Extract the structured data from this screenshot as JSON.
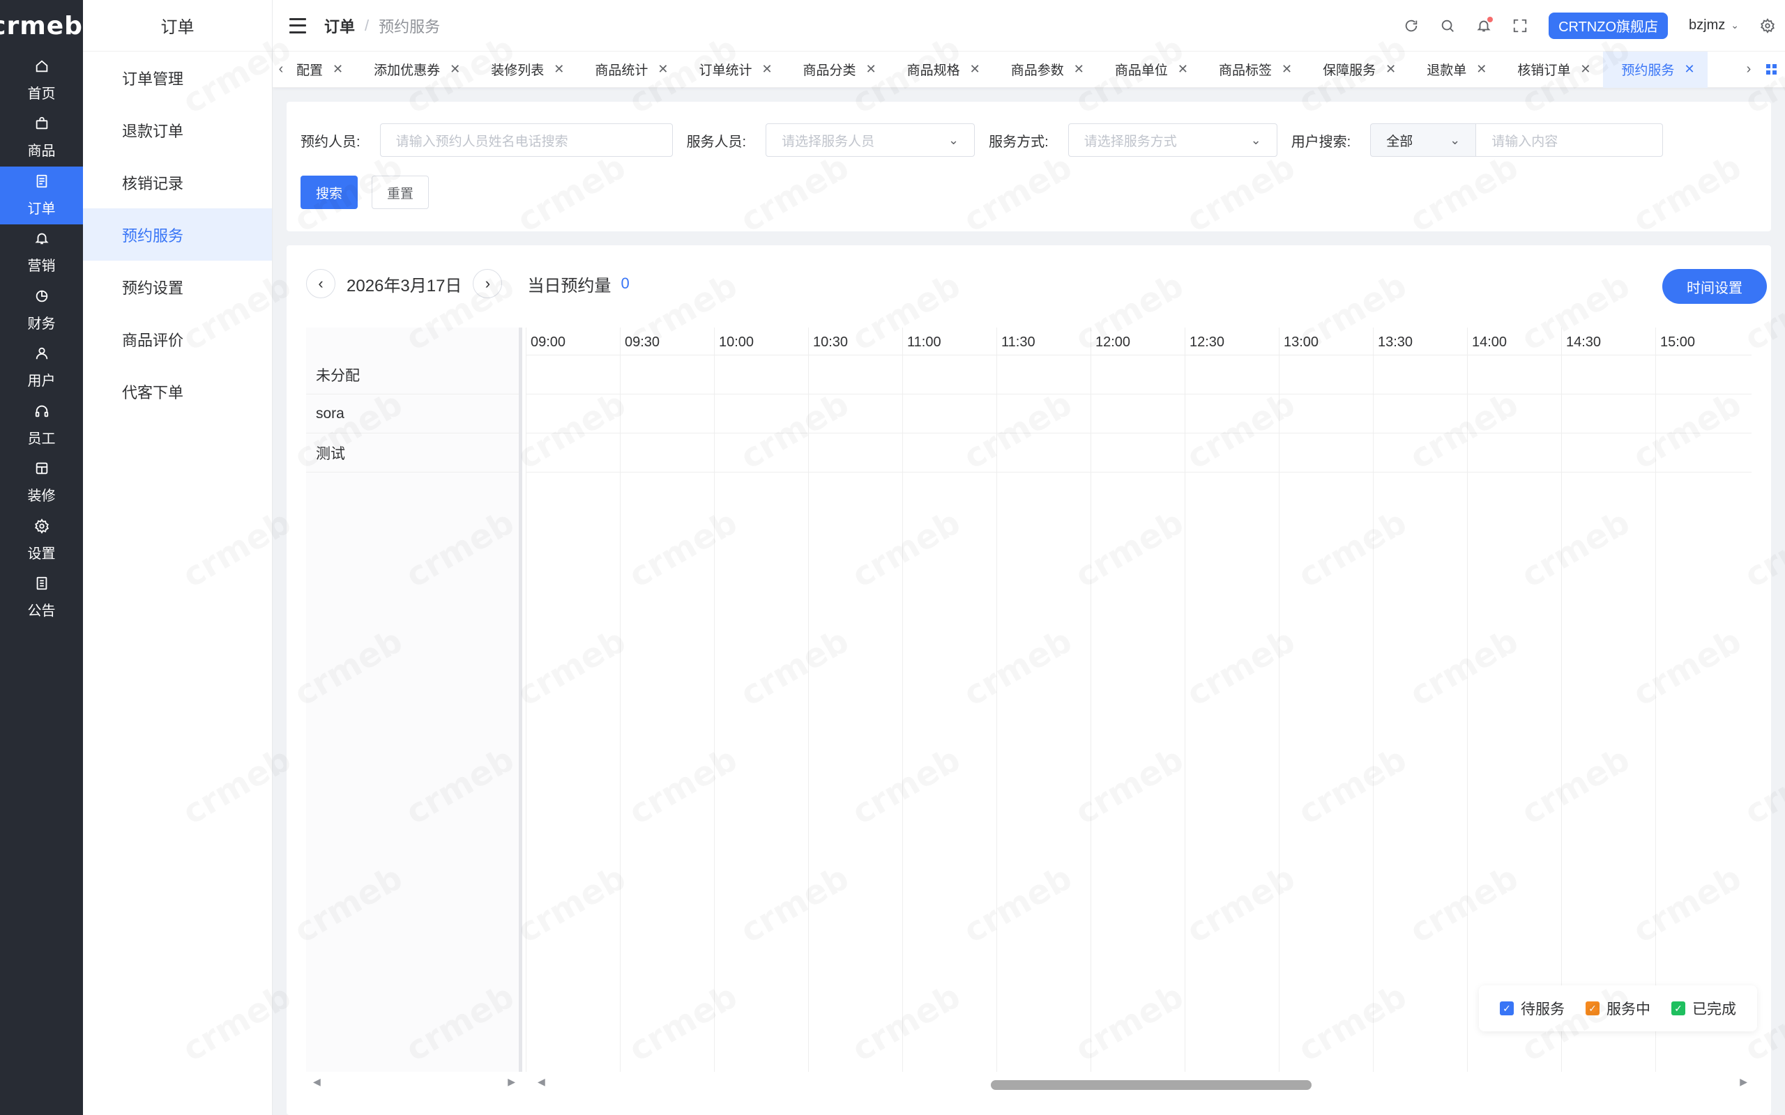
{
  "brand": {
    "logo_text": "crmeb",
    "logo_mark": "®"
  },
  "primary_nav": [
    {
      "label": "首页",
      "icon": "home-icon",
      "active": false
    },
    {
      "label": "商品",
      "icon": "bag-icon",
      "active": false
    },
    {
      "label": "订单",
      "icon": "document-icon",
      "active": true
    },
    {
      "label": "营销",
      "icon": "bell-icon",
      "active": false
    },
    {
      "label": "财务",
      "icon": "pie-chart-icon",
      "active": false
    },
    {
      "label": "用户",
      "icon": "user-icon",
      "active": false
    },
    {
      "label": "员工",
      "icon": "headset-icon",
      "active": false
    },
    {
      "label": "装修",
      "icon": "shirt-icon",
      "active": false
    },
    {
      "label": "设置",
      "icon": "gear-icon",
      "active": false
    },
    {
      "label": "公告",
      "icon": "notice-icon",
      "active": false
    }
  ],
  "secondary_nav": {
    "title": "订单",
    "items": [
      {
        "label": "订单管理",
        "active": false
      },
      {
        "label": "退款订单",
        "active": false
      },
      {
        "label": "核销记录",
        "active": false
      },
      {
        "label": "预约服务",
        "active": true
      },
      {
        "label": "预约设置",
        "active": false
      },
      {
        "label": "商品评价",
        "active": false
      },
      {
        "label": "代客下单",
        "active": false
      }
    ]
  },
  "header": {
    "breadcrumb": [
      "订单",
      "预约服务"
    ],
    "breadcrumb_sep": "/",
    "store_button": "CRTNZO旗舰店",
    "username": "bzjmz"
  },
  "tabs": [
    {
      "label": "配置",
      "active": false
    },
    {
      "label": "添加优惠券",
      "active": false
    },
    {
      "label": "装修列表",
      "active": false
    },
    {
      "label": "商品统计",
      "active": false
    },
    {
      "label": "订单统计",
      "active": false
    },
    {
      "label": "商品分类",
      "active": false
    },
    {
      "label": "商品规格",
      "active": false
    },
    {
      "label": "商品参数",
      "active": false
    },
    {
      "label": "商品单位",
      "active": false
    },
    {
      "label": "商品标签",
      "active": false
    },
    {
      "label": "保障服务",
      "active": false
    },
    {
      "label": "退款单",
      "active": false
    },
    {
      "label": "核销订单",
      "active": false
    },
    {
      "label": "预约服务",
      "active": true
    }
  ],
  "filter": {
    "booker_label": "预约人员:",
    "booker_placeholder": "请输入预约人员姓名电话搜索",
    "staff_label": "服务人员:",
    "staff_placeholder": "请选择服务人员",
    "method_label": "服务方式:",
    "method_placeholder": "请选择服务方式",
    "user_label": "用户搜索:",
    "user_type_value": "全部",
    "user_placeholder": "请输入内容",
    "search_button": "搜索",
    "reset_button": "重置"
  },
  "schedule": {
    "date": "2026年3月17日",
    "day_count_label": "当日预约量",
    "day_count": "0",
    "time_settings_button": "时间设置",
    "times": [
      "09:00",
      "09:30",
      "10:00",
      "10:30",
      "11:00",
      "11:30",
      "12:00",
      "12:30",
      "13:00",
      "13:30",
      "14:00",
      "14:30",
      "15:00"
    ],
    "resources": [
      "未分配",
      "sora",
      "测试"
    ]
  },
  "legend": [
    {
      "label": "待服务",
      "color": "#3875f6"
    },
    {
      "label": "服务中",
      "color": "#f5891f"
    },
    {
      "label": "已完成",
      "color": "#1fbf5f"
    }
  ],
  "colors": {
    "primary": "#3875f6",
    "sidebar": "#282c34"
  }
}
